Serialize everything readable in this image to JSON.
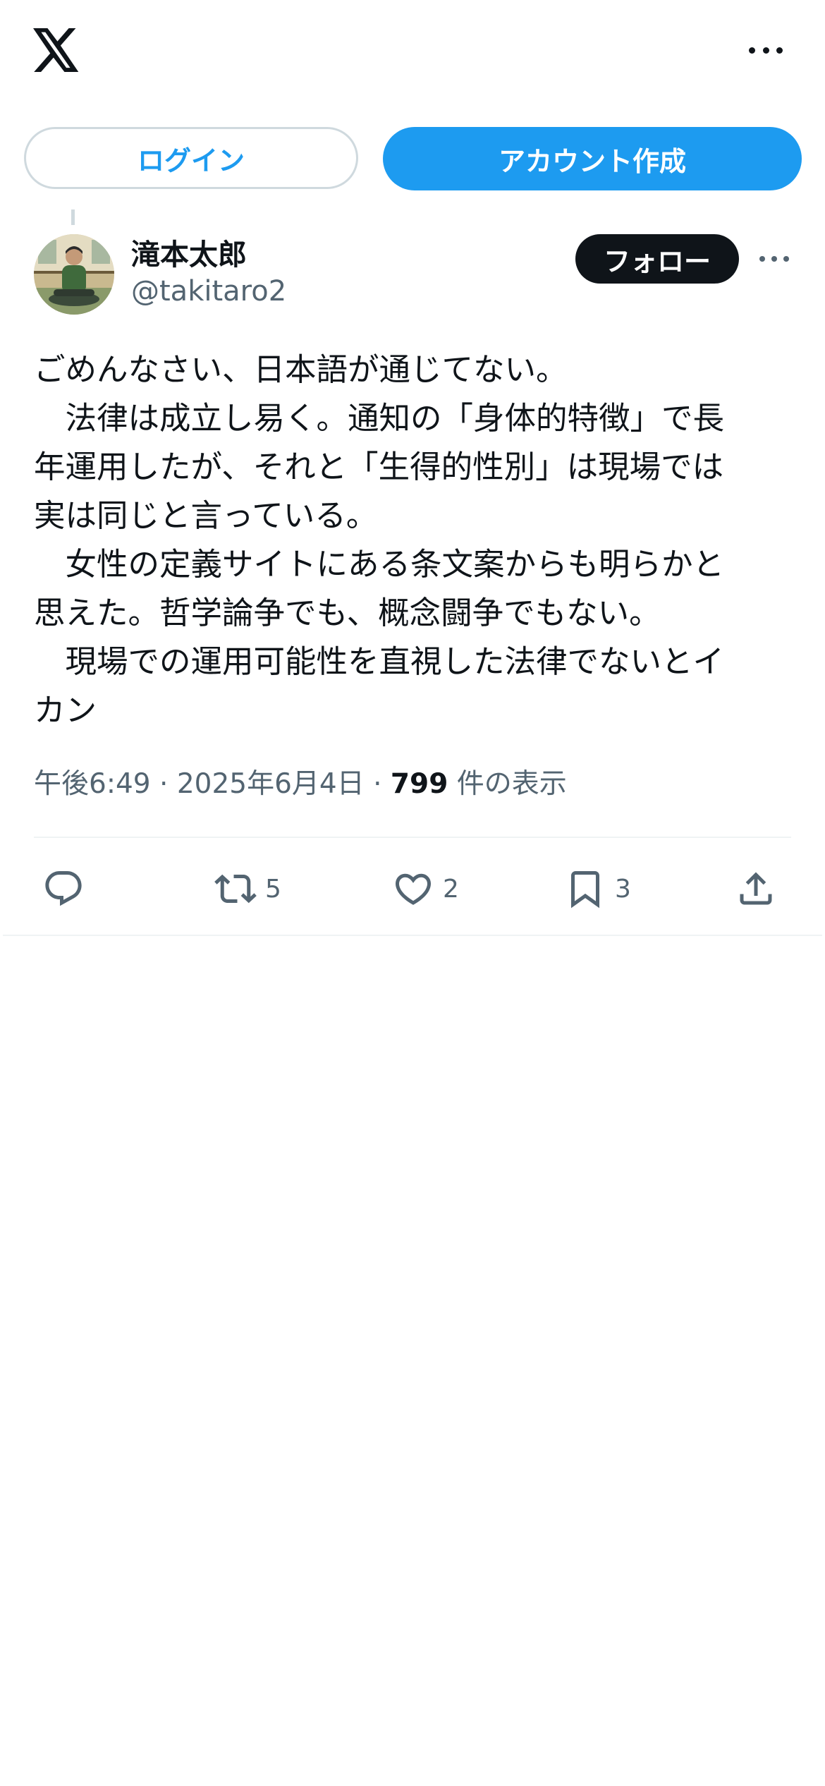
{
  "app": {
    "logo_icon": "x-logo-icon",
    "more_icon": "more-horizontal-icon"
  },
  "auth": {
    "login_label": "ログイン",
    "signup_label": "アカウント作成"
  },
  "post": {
    "author": {
      "name": "滝本太郎",
      "handle": "@takitaro2"
    },
    "follow_label": "フォロー",
    "text_lines": [
      "ごめんなさい、日本語が通じてない。",
      "　法律は成立し易く。通知の「身体的特徴」で長",
      "年運用したが、それと「生得的性別」は現場では",
      "実は同じと言っている。",
      "　女性の定義サイトにある条文案からも明らかと",
      "思えた。哲学論争でも、概念闘争でもない。",
      "　現場での運用可能性を直視した法律でないとイ",
      "カン"
    ],
    "time": "午後6:49",
    "separator": "·",
    "date": "2025年6月4日",
    "views_count": "799",
    "views_label": "件の表示",
    "actions": {
      "reply_icon": "reply-icon",
      "repost_icon": "repost-icon",
      "repost_count": "5",
      "like_icon": "heart-icon",
      "like_count": "2",
      "bookmark_icon": "bookmark-icon",
      "bookmark_count": "3",
      "share_icon": "share-icon"
    }
  },
  "colors": {
    "accent": "#1d9bf0",
    "text_primary": "#0f1419",
    "text_secondary": "#536471",
    "border": "#cfd9de",
    "divider": "#eff3f4"
  }
}
